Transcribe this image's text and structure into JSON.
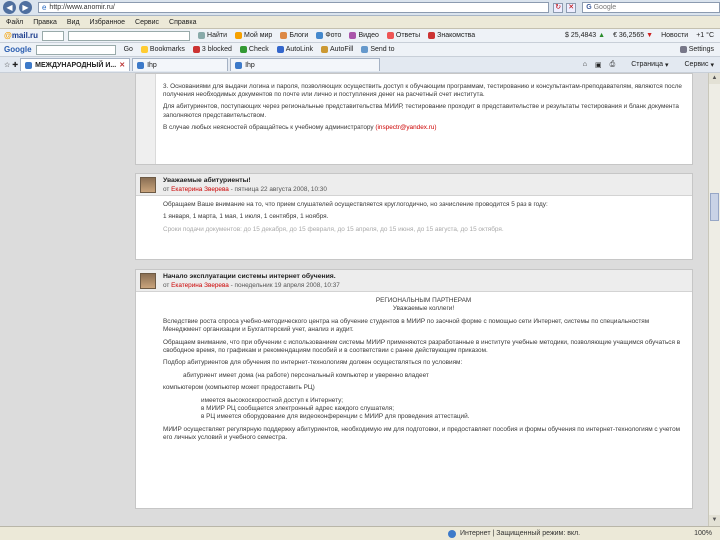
{
  "address_bar": {
    "url": "http://www.anomir.ru/",
    "search_placeholder": "Google"
  },
  "menu": [
    "Файл",
    "Правка",
    "Вид",
    "Избранное",
    "Сервис",
    "Справка"
  ],
  "mail_toolbar": {
    "logo_prefix": "@",
    "logo_text": "mail.ru",
    "search_button": "Найти",
    "items": [
      "Мой мир",
      "Блоги",
      "Фото",
      "Видео",
      "Ответы",
      "Знакомства"
    ],
    "rate_usd": "$ 25,4843",
    "rate_eur": "€ 36,2565",
    "news": "Новости",
    "weather": "+1 °С"
  },
  "google_toolbar": {
    "logo": "Google",
    "go_button": "Go",
    "items": [
      "Bookmarks",
      "3 blocked",
      "Check",
      "AutoLink",
      "AutoFill",
      "Send to"
    ],
    "settings": "Settings"
  },
  "tabs": [
    {
      "label": "МЕЖДУНАРОДНЫЙ И...",
      "active": true
    },
    {
      "label": "Ihp",
      "active": false
    },
    {
      "label": "Ihp",
      "active": false
    }
  ],
  "tab_tools": {
    "page": "Страница",
    "tools": "Сервис"
  },
  "post1": {
    "lines": [
      "3. Основаниями для выдачи логина и пароля, позволяющих осуществить доступ к обучающим программам, тестированию и консультантам-преподавателям, являются после получения необходимых документов по почте или лично и поступления денег на расчетный счет института.",
      "Для абитуриентов, поступающих через региональные представительства МИИР, тестирование проходит в представительстве и результаты тестирования и бланк документа заполняются представительством.",
      "В случае любых неясностей обращайтесь к учебному администратору"
    ],
    "email": "(inspectr@yandex.ru)"
  },
  "post2": {
    "title": "Уважаемые абитуриенты!",
    "by": "от",
    "author": "Екатерина Зверева",
    "date": "пятница 22 августа 2008, 10:30",
    "lines": [
      "Обращаем Ваше внимание на то, что прием слушателей осуществляется круглогодично, но зачисление проводится 5 раз в году:",
      "1 января, 1 марта, 1 мая, 1 июля, 1 сентября, 1 ноября."
    ],
    "faded": "Сроки подачи документов: до 15 декабря, до 15 февраля, до 15 апреля, до 15 июня, до 15 августа, до 15 октября."
  },
  "post3": {
    "title": "Начало эксплуатации системы интернет обучения.",
    "by": "от",
    "author": "Екатерина Зверева",
    "date": "понедельник 19 апреля 2008, 10:37",
    "heading1": "РЕГИОНАЛЬНЫМ ПАРТНЕРАМ",
    "heading2": "Уважаемые коллеги!",
    "lines": [
      "Вследствие роста спроса учебно-методического центра на обучение студентов в МИИР по заочной форме с помощью сети Интернет, системы по специальностям Менеджмент организации и Бухгалтерский учет, анализ и аудит.",
      "Обращаем внимание, что при обучении с использованием системы МИИР применяются разработанные в институте учебные методики, позволяющие учащимся обучаться в свободное время, по графикам и рекомендациям пособий и в соответствии с ранее действующим приказом.",
      "Подбор абитуриентов для обучения по интернет-технологиям должен осуществляться по условиям:",
      "абитуриент имеет дома (на работе) персональный компьютер и уверенно владеет",
      "компьютером (компьютер может предоставить РЦ)",
      "имеется высокоскоростной доступ к Интернету;",
      "в МИИР РЦ сообщается электронный адрес каждого слушателя;",
      "в РЦ имеется оборудование для видеоконференции с МИИР для проведения аттестаций.",
      "МИИР осуществляет регулярную поддержку абитуриентов, необходимую им для подготовки, и предоставляет пособия и формы обучения по интернет-технологиям с учетом его личных условий и учебного семестра."
    ]
  },
  "status": {
    "zone": "Интернет | Защищенный режим: вкл.",
    "zoom": "100%"
  },
  "colors": {
    "accent": "#cc0000",
    "link": "#2a5db0"
  }
}
